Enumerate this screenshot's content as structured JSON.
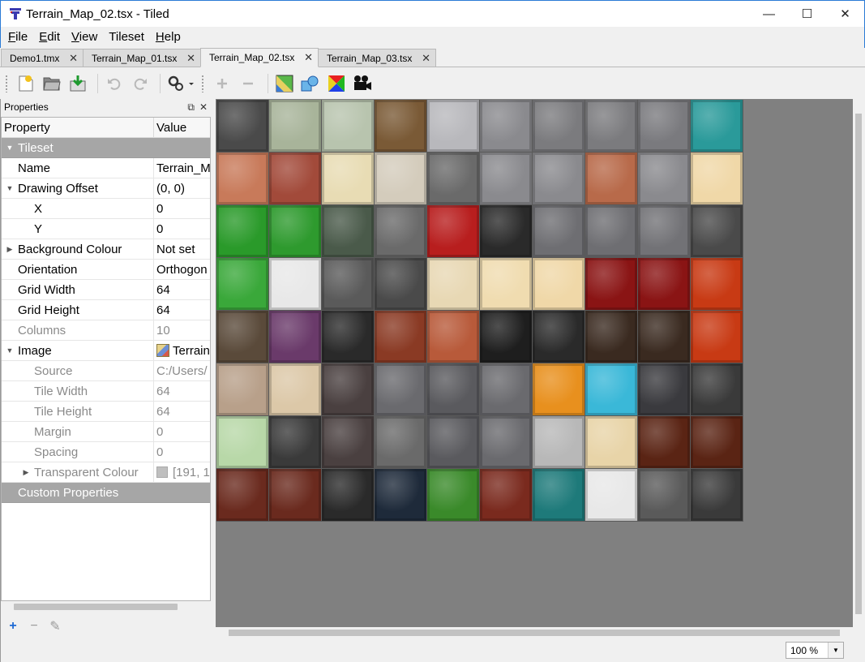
{
  "window": {
    "title": "Terrain_Map_02.tsx - Tiled",
    "min_glyph": "—",
    "max_glyph": "☐",
    "close_glyph": "✕"
  },
  "menu": [
    {
      "label": "File",
      "accel": "F",
      "rest": "ile"
    },
    {
      "label": "Edit",
      "accel": "E",
      "rest": "dit"
    },
    {
      "label": "View",
      "accel": "V",
      "rest": "iew"
    },
    {
      "label": "Tileset",
      "accel": "",
      "rest": "Tileset"
    },
    {
      "label": "Help",
      "accel": "H",
      "rest": "elp"
    }
  ],
  "tabs": [
    {
      "label": "Demo1.tmx",
      "active": false
    },
    {
      "label": "Terrain_Map_01.tsx",
      "active": false
    },
    {
      "label": "Terrain_Map_02.tsx",
      "active": true
    },
    {
      "label": "Terrain_Map_03.tsx",
      "active": false
    }
  ],
  "toolbar": {
    "buttons": [
      "new-file-icon",
      "open-file-icon",
      "save-file-icon",
      "undo-icon",
      "redo-icon",
      "automap-icon",
      "add-tile-icon",
      "remove-tile-icon",
      "terrain-icon",
      "collision-icon",
      "wang-icon",
      "animation-icon"
    ]
  },
  "properties": {
    "dock_title": "Properties",
    "header_property": "Property",
    "header_value": "Value",
    "rows": [
      {
        "type": "group",
        "arrow": "▼",
        "name": "Tileset",
        "value": ""
      },
      {
        "type": "row",
        "indent": 1,
        "arrow": "",
        "name": "Name",
        "value": "Terrain_M"
      },
      {
        "type": "row",
        "indent": 1,
        "arrow": "▼",
        "name": "Drawing Offset",
        "value": "(0, 0)"
      },
      {
        "type": "row",
        "indent": 2,
        "arrow": "",
        "name": "X",
        "value": "0"
      },
      {
        "type": "row",
        "indent": 2,
        "arrow": "",
        "name": "Y",
        "value": "0"
      },
      {
        "type": "row",
        "indent": 1,
        "arrow": "▶",
        "name": "Background Colour",
        "value": "Not set"
      },
      {
        "type": "row",
        "indent": 1,
        "arrow": "",
        "name": "Orientation",
        "value": "Orthogon"
      },
      {
        "type": "row",
        "indent": 1,
        "arrow": "",
        "name": "Grid Width",
        "value": "64"
      },
      {
        "type": "row",
        "indent": 1,
        "arrow": "",
        "name": "Grid Height",
        "value": "64"
      },
      {
        "type": "readonly",
        "indent": 1,
        "arrow": "",
        "name": "Columns",
        "value": "10"
      },
      {
        "type": "row",
        "indent": 1,
        "arrow": "▼",
        "name": "Image",
        "value": "Terrain",
        "chip": "image"
      },
      {
        "type": "readonly",
        "indent": 2,
        "arrow": "",
        "name": "Source",
        "value": "C:/Users/"
      },
      {
        "type": "readonly",
        "indent": 2,
        "arrow": "",
        "name": "Tile Width",
        "value": "64"
      },
      {
        "type": "readonly",
        "indent": 2,
        "arrow": "",
        "name": "Tile Height",
        "value": "64"
      },
      {
        "type": "readonly",
        "indent": 2,
        "arrow": "",
        "name": "Margin",
        "value": "0"
      },
      {
        "type": "readonly",
        "indent": 2,
        "arrow": "",
        "name": "Spacing",
        "value": "0"
      },
      {
        "type": "readonly",
        "indent": 2,
        "arrow": "▶",
        "name": "Transparent Colour",
        "value": "[191, 1",
        "chip": "swatch"
      },
      {
        "type": "group",
        "arrow": "",
        "name": "Custom Properties",
        "value": ""
      }
    ]
  },
  "tiles": {
    "columns": 10,
    "rows": 8,
    "colors": [
      "#4a4a4a",
      "#a8b49a",
      "#b8c4ae",
      "#7a5a36",
      "#b8b8bc",
      "#8a8a8e",
      "#7b7b7e",
      "#7b7b7e",
      "#7a7a7e",
      "#2a9a9a",
      "#c87a5a",
      "#a24a3a",
      "#e8dcb4",
      "#d4ccbc",
      "#6a6a6a",
      "#8a8a8e",
      "#8a8a8e",
      "#b86a4a",
      "#8a8a8e",
      "#f0d8a8",
      "#2a9a2a",
      "#2e9a2e",
      "#4a5a4a",
      "#6a6a6a",
      "#b81e1e",
      "#2a2a2a",
      "#6e6e72",
      "#6e6e72",
      "#727276",
      "#4a4a4a",
      "#3aa83a",
      "#e8e8e8",
      "#5a5a5a",
      "#4a4a4a",
      "#e8d8b4",
      "#f0dcb0",
      "#f0d8a8",
      "#8a1414",
      "#8a1414",
      "#c83a14",
      "#5a4a3a",
      "#6a3a6a",
      "#2a2a2a",
      "#8a3a24",
      "#b85a3a",
      "#1e1e1e",
      "#2a2a2a",
      "#3a2a20",
      "#3a2a20",
      "#c83a14",
      "#b8a08a",
      "#dcc8a8",
      "#4a4040",
      "#6a6a6e",
      "#5a5a5e",
      "#6a6a6e",
      "#e8901e",
      "#3ab8d8",
      "#3a3a3e",
      "#3a3a3a",
      "#b8d8a8",
      "#3a3a3a",
      "#4a4040",
      "#6a6a6a",
      "#5a5a5e",
      "#6a6a6e",
      "#b8b8b8",
      "#e8d4a8",
      "#5a2414",
      "#5a2414",
      "#6a2a1e",
      "#6a2a1e",
      "#2a2a2a",
      "#1e2a3a",
      "#3a8a2a",
      "#7a2a1e",
      "#1e7a7a",
      "#e8e8e8",
      "#5a5a5a",
      "#3a3a3a"
    ]
  },
  "status": {
    "zoom": "100 %"
  }
}
